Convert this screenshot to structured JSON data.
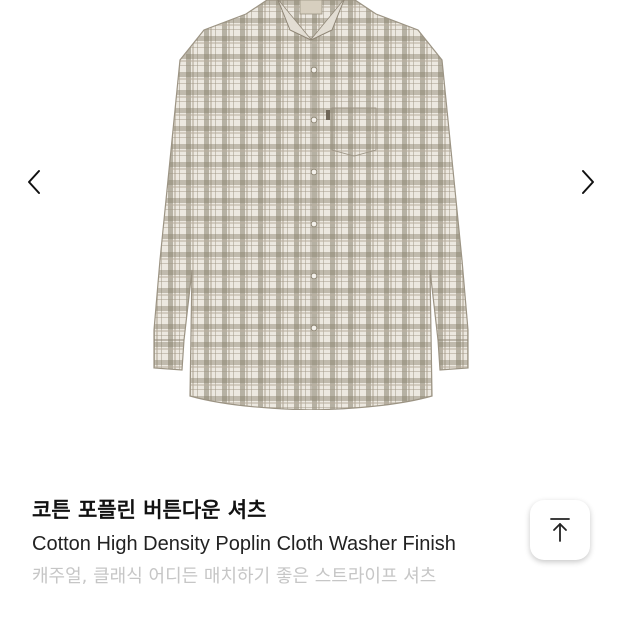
{
  "gallery": {
    "image_alt": "product-image-plaid-shirt",
    "prev_icon": "chevron-left-icon",
    "next_icon": "chevron-right-icon"
  },
  "product": {
    "title_ko": "코튼 포플린 버튼다운 셔츠",
    "title_en": "Cotton High Density Poplin Cloth Washer Finish",
    "subtitle": "캐주얼, 클래식 어디든 매치하기 좋은 스트라이프 셔츠"
  },
  "scroll_top": {
    "icon": "arrow-up-to-top-icon"
  },
  "colors": {
    "check_base": "#ece8e0",
    "check_dark": "#8a8270",
    "title_text": "#111111",
    "subtitle_text": "#c6c6c6"
  }
}
